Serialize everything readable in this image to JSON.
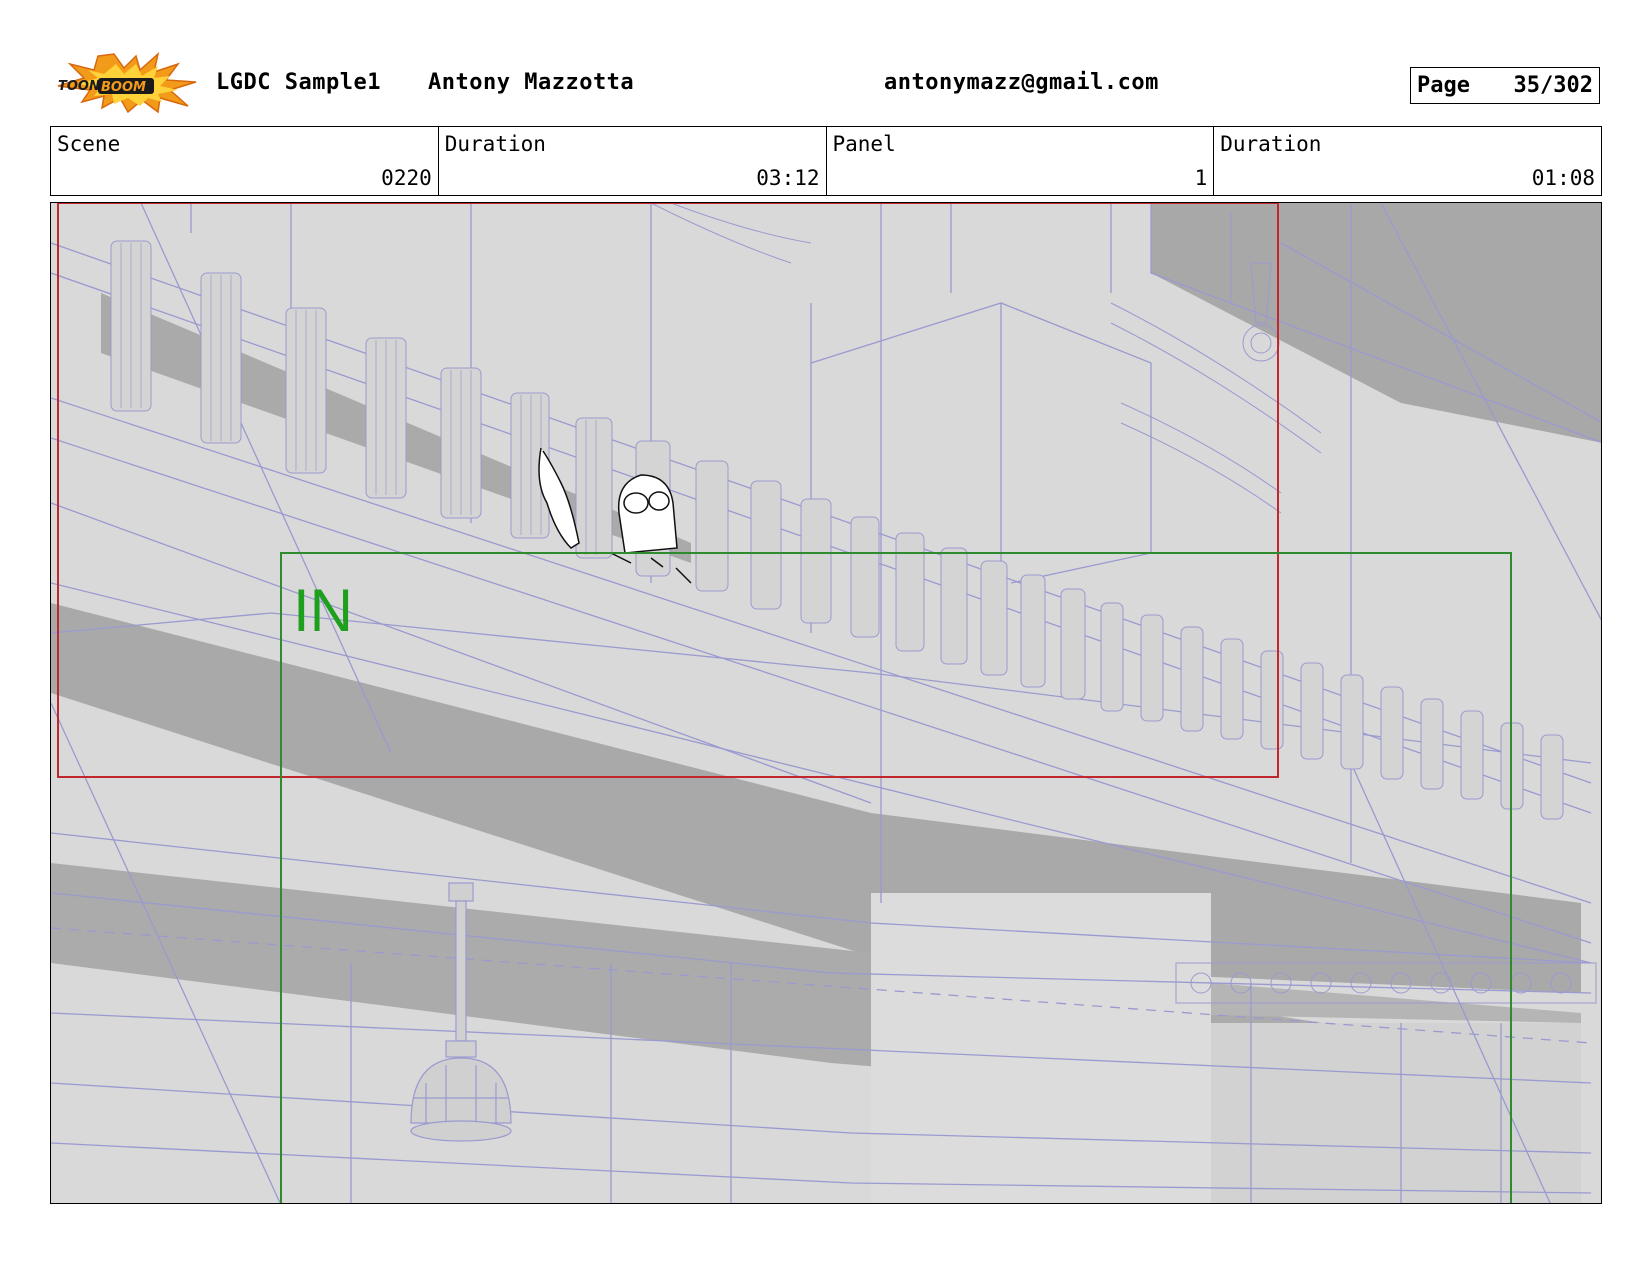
{
  "header": {
    "project": "LGDC Sample1",
    "author": "Antony Mazzotta",
    "email": "antonymazz@gmail.com",
    "page_label": "Page",
    "page_value": "35/302",
    "logo_text_a": "TOON",
    "logo_text_b": "BOOM"
  },
  "info": {
    "scene_label": "Scene",
    "scene_value": "0220",
    "duration_label": "Duration",
    "duration_value": "03:12",
    "panel_label": "Panel",
    "panel_value": "1",
    "panel_duration_label": "Duration",
    "panel_duration_value": "01:08"
  },
  "panel": {
    "in_label": "IN",
    "colors": {
      "wireframe": "#9a9ad0",
      "in_frame": "#2e8b2e",
      "camera_frame": "#c0282d",
      "bg_light": "#d9d9d9",
      "bg_dark": "#a9a9a9"
    }
  }
}
